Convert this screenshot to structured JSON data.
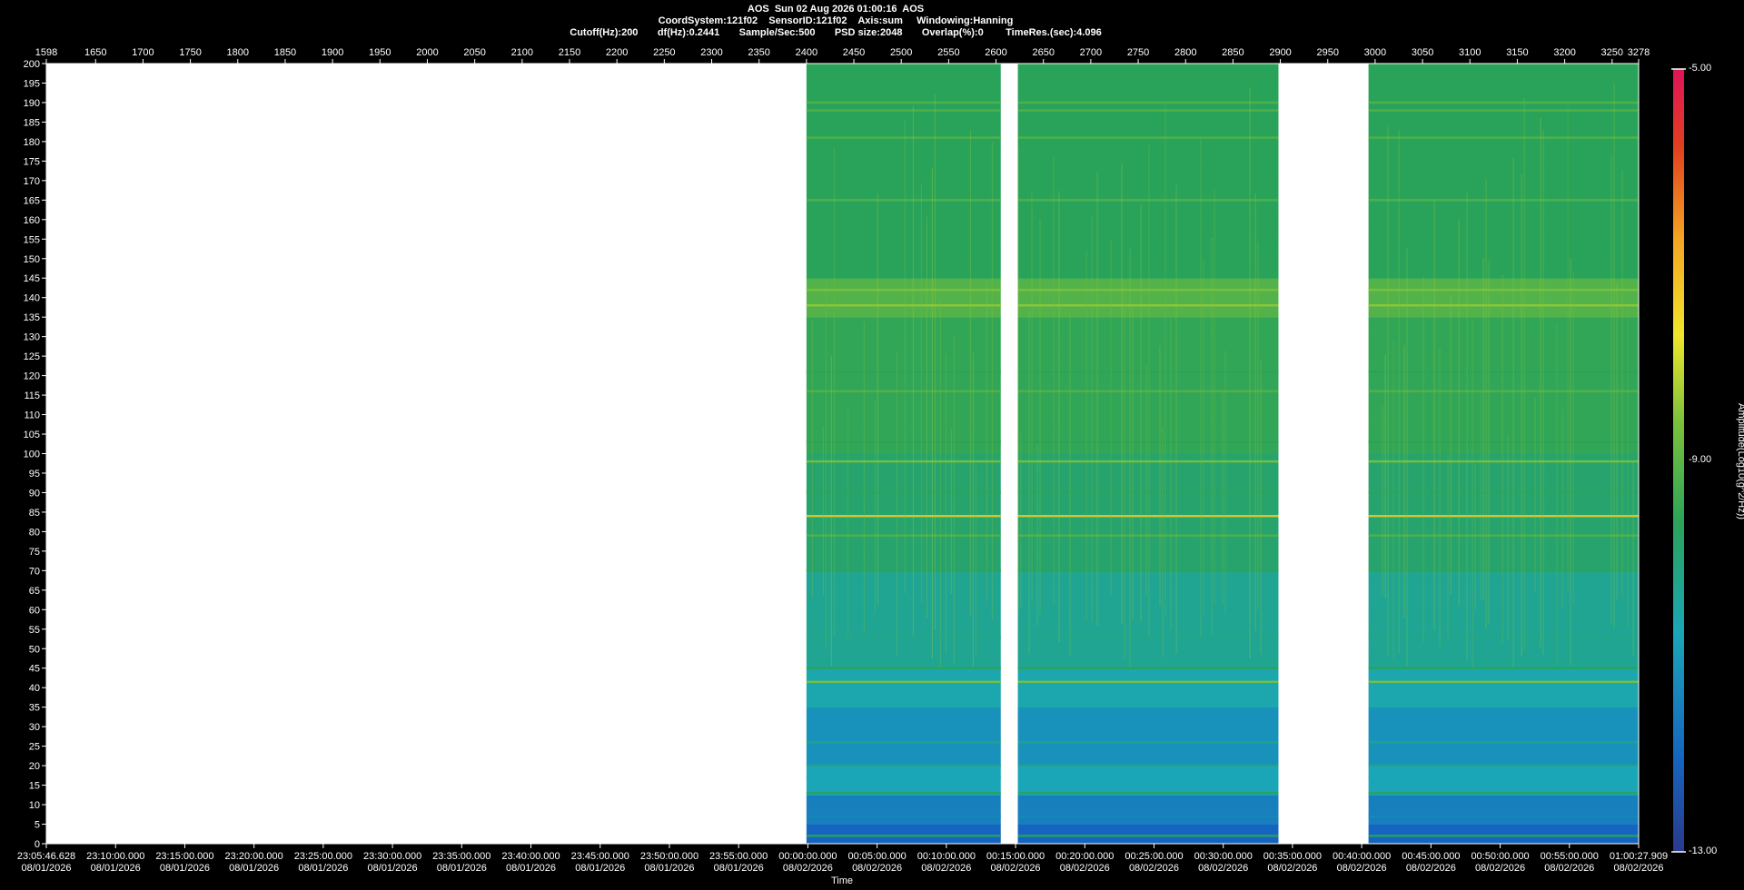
{
  "header": {
    "line1": "AOS  Sun 02 Aug 2026 01:00:16  AOS",
    "line2": "CoordSystem:121f02    SensorID:121f02    Axis:sum     Windowing:Hanning",
    "line3": "Cutoff(Hz):200       df(Hz):0.2441       Sample/Sec:500       PSD size:2048       Overlap(%):0        TimeRes.(sec):4.096"
  },
  "chart_data": {
    "type": "heatmap",
    "title": "AOS  Sun 02 Aug 2026 01:00:16  AOS",
    "xlabel": "Time",
    "ylabel": "",
    "colorbar_label": "Amplitude(Log10(g^2/Hz))",
    "colorbar_ticks": [
      "-5.00",
      "-9.00",
      "-13.00"
    ],
    "zlim": [
      -13,
      -5
    ],
    "top_axis": {
      "range": [
        1598,
        3278
      ],
      "ticks": [
        "1598",
        "1650",
        "1700",
        "1750",
        "1800",
        "1850",
        "1900",
        "1950",
        "2000",
        "2050",
        "2100",
        "2150",
        "2200",
        "2250",
        "2300",
        "2350",
        "2400",
        "2450",
        "2500",
        "2550",
        "2600",
        "2650",
        "2700",
        "2750",
        "2800",
        "2850",
        "2900",
        "2950",
        "3000",
        "3050",
        "3100",
        "3150",
        "3200",
        "3250",
        "3278"
      ]
    },
    "y_axis": {
      "range": [
        0,
        200
      ],
      "ticks": [
        "0",
        "5",
        "10",
        "15",
        "20",
        "25",
        "30",
        "35",
        "40",
        "45",
        "50",
        "55",
        "60",
        "65",
        "70",
        "75",
        "80",
        "85",
        "90",
        "95",
        "100",
        "105",
        "110",
        "115",
        "120",
        "125",
        "130",
        "135",
        "140",
        "145",
        "150",
        "155",
        "160",
        "165",
        "170",
        "175",
        "180",
        "185",
        "190",
        "195",
        "200"
      ]
    },
    "x_axis": {
      "range": [
        "23:05:46.628 08/01/2026",
        "01:00:27.909 08/02/2026"
      ],
      "ticks": [
        {
          "time": "23:05:46.628",
          "date": "08/01/2026"
        },
        {
          "time": "23:10:00.000",
          "date": "08/01/2026"
        },
        {
          "time": "23:15:00.000",
          "date": "08/01/2026"
        },
        {
          "time": "23:20:00.000",
          "date": "08/01/2026"
        },
        {
          "time": "23:25:00.000",
          "date": "08/01/2026"
        },
        {
          "time": "23:30:00.000",
          "date": "08/01/2026"
        },
        {
          "time": "23:35:00.000",
          "date": "08/01/2026"
        },
        {
          "time": "23:40:00.000",
          "date": "08/01/2026"
        },
        {
          "time": "23:45:00.000",
          "date": "08/01/2026"
        },
        {
          "time": "23:50:00.000",
          "date": "08/01/2026"
        },
        {
          "time": "23:55:00.000",
          "date": "08/01/2026"
        },
        {
          "time": "00:00:00.000",
          "date": "08/02/2026"
        },
        {
          "time": "00:05:00.000",
          "date": "08/02/2026"
        },
        {
          "time": "00:10:00.000",
          "date": "08/02/2026"
        },
        {
          "time": "00:15:00.000",
          "date": "08/02/2026"
        },
        {
          "time": "00:20:00.000",
          "date": "08/02/2026"
        },
        {
          "time": "00:25:00.000",
          "date": "08/02/2026"
        },
        {
          "time": "00:30:00.000",
          "date": "08/02/2026"
        },
        {
          "time": "00:35:00.000",
          "date": "08/02/2026"
        },
        {
          "time": "00:40:00.000",
          "date": "08/02/2026"
        },
        {
          "time": "00:45:00.000",
          "date": "08/02/2026"
        },
        {
          "time": "00:50:00.000",
          "date": "08/02/2026"
        },
        {
          "time": "00:55:00.000",
          "date": "08/02/2026"
        },
        {
          "time": "01:00:27.909",
          "date": "08/02/2026"
        }
      ]
    },
    "data_segments": [
      {
        "start": 2400,
        "end": 2605
      },
      {
        "start": 2623,
        "end": 2898
      },
      {
        "start": 2993,
        "end": 3278
      }
    ],
    "spectral_lines_hz": [
      {
        "hz": 2,
        "level": -10.0
      },
      {
        "hz": 7,
        "level": -11.5
      },
      {
        "hz": 13,
        "level": -10.0
      },
      {
        "hz": 17,
        "level": -11.0
      },
      {
        "hz": 20,
        "level": -10.5
      },
      {
        "hz": 26,
        "level": -10.5
      },
      {
        "hz": 41.5,
        "level": -9.0
      },
      {
        "hz": 45,
        "level": -10.0
      },
      {
        "hz": 53,
        "level": -10.5
      },
      {
        "hz": 70,
        "level": -10.0
      },
      {
        "hz": 79,
        "level": -9.5
      },
      {
        "hz": 84,
        "level": -7.5
      },
      {
        "hz": 90,
        "level": -10.0
      },
      {
        "hz": 98,
        "level": -9.0
      },
      {
        "hz": 103,
        "level": -10.0
      },
      {
        "hz": 116,
        "level": -9.5
      },
      {
        "hz": 121,
        "level": -10.0
      },
      {
        "hz": 138,
        "level": -8.8
      },
      {
        "hz": 142,
        "level": -9.0
      },
      {
        "hz": 165,
        "level": -9.5
      },
      {
        "hz": 181,
        "level": -9.5
      },
      {
        "hz": 188,
        "level": -9.5
      },
      {
        "hz": 190,
        "level": -9.5
      }
    ],
    "colors": {
      "background": "#000000",
      "empty_region": "#ffffff",
      "colormap": [
        "#2a3a8c",
        "#1565c0",
        "#1aa6b7",
        "#2aa35a",
        "#7cc23a",
        "#f0e62a",
        "#f5a623",
        "#e0401e",
        "#e0135a"
      ]
    }
  }
}
